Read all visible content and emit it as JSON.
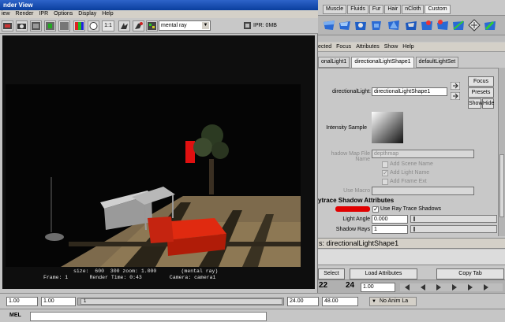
{
  "render_view": {
    "title": "nder View",
    "menu": [
      "iew",
      "Render",
      "IPR",
      "Options",
      "Display",
      "Help"
    ],
    "toolbar": {
      "renderer": "mental ray",
      "ipr_status": "IPR: 0MB",
      "ratio_label": "1:1"
    },
    "info_line1": "size:  600  300 zoom: 1.000        (mental ray)",
    "info_line2": "Frame: 1       Render Time: 0:43         Camera: camera1"
  },
  "shelf": {
    "tabs": [
      "Muscle",
      "Fluids",
      "Fur",
      "Hair",
      "nCloth",
      "Custom"
    ]
  },
  "attribute_editor": {
    "menu": [
      "ected",
      "Focus",
      "Attributes",
      "Show",
      "Help"
    ],
    "tabs": [
      "onalLight1",
      "directionalLightShape1",
      "defaultLightSet"
    ],
    "node_label": "directionalLight:",
    "node_value": "directionalLightShape1",
    "buttons": {
      "focus": "Focus",
      "presets": "Presets",
      "show": "Show",
      "hide": "Hide"
    },
    "intensity_sample_label": "Intensity Sample",
    "shadow_map": {
      "file_label": "hadow Map File Name",
      "file_value": "depthmap",
      "add_scene_name": "Add Scene Name",
      "add_light_name": "Add Light Name",
      "add_frame_ext": "Add Frame Ext",
      "use_macro": "Use Macro"
    },
    "raytrace": {
      "section_title": "ytrace Shadow Attributes",
      "use_ray_trace_shadows": "Use Ray Trace Shadows",
      "light_angle_label": "Light Angle",
      "light_angle_value": "0.000",
      "shadow_rays_label": "Shadow Rays",
      "shadow_rays_value": "1"
    },
    "node_name": "s:  directionalLightShape1",
    "bottom_buttons": {
      "select": "Select",
      "load_attributes": "Load Attributes",
      "copy_tab": "Copy Tab"
    }
  },
  "timeline": {
    "tick_a": "22",
    "tick_b": "24"
  },
  "range_slider": {
    "start_a": "1.00",
    "start_b": "1.00",
    "thumb_label": "1",
    "end_a": "24.00",
    "end_b": "48.00",
    "anim_layer": "No Anim La"
  },
  "command_line": {
    "label": "MEL"
  },
  "colors": {
    "title_bar": "#1b53b8",
    "red_swatch": "#e00000"
  }
}
